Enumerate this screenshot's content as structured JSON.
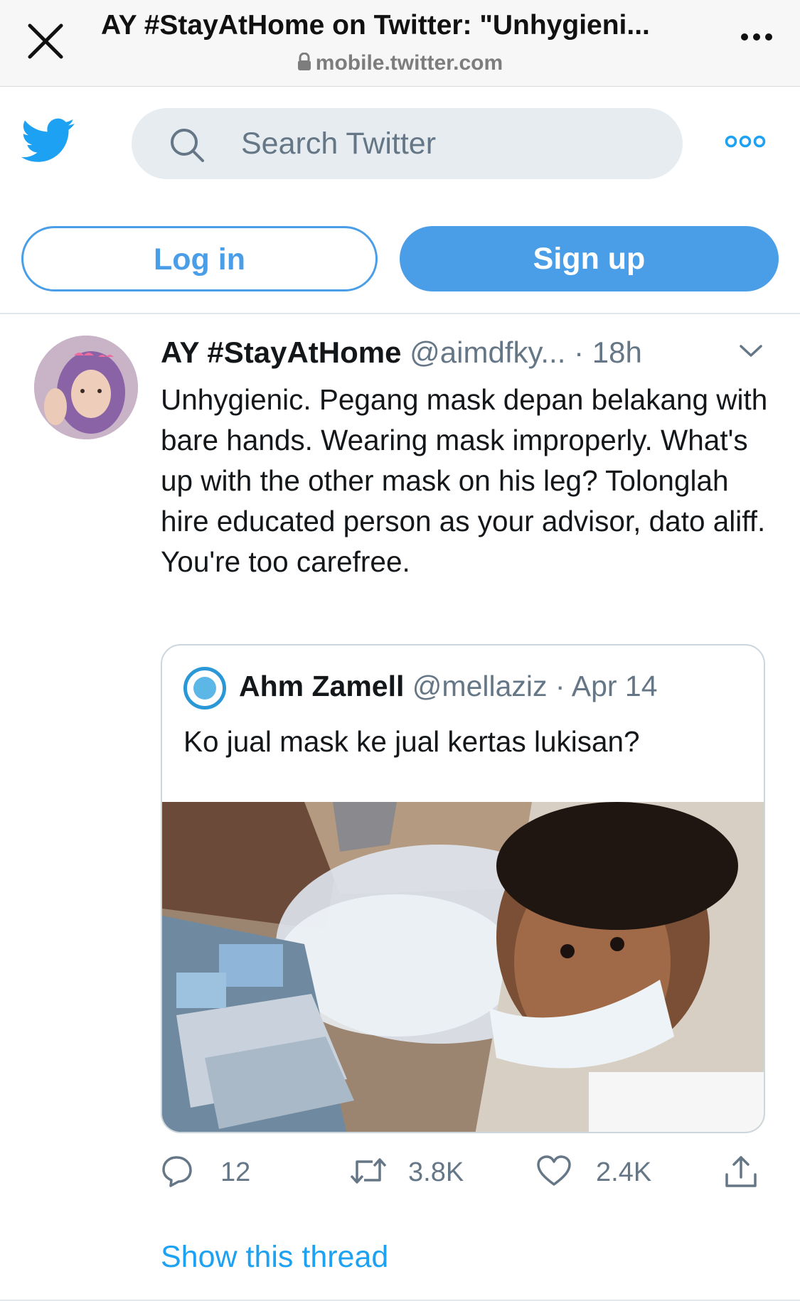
{
  "browser": {
    "title": "AY #StayAtHome on Twitter: \"Unhygieni...",
    "url": "mobile.twitter.com",
    "icons": [
      "close-icon",
      "lock-icon",
      "more-icon"
    ]
  },
  "header": {
    "search_placeholder": "Search Twitter",
    "login_label": "Log in",
    "signup_label": "Sign up",
    "icons": [
      "twitter-logo-icon",
      "search-icon",
      "more-options-icon"
    ]
  },
  "tweet": {
    "author_name": "AY #StayAtHome",
    "author_handle": "@aimdfky...",
    "separator": "·",
    "time": "18h",
    "text": "Unhygienic. Pegang mask depan belakang with bare hands. Wearing mask improperly. What's up with the other mask on his leg? Tolonglah hire educated person as your advisor, dato aliff. You're too carefree.",
    "quote": {
      "author_name": "Ahm Zamell",
      "author_handle": "@mellaziz",
      "separator": "·",
      "date": "Apr 14",
      "text": "Ko jual mask ke jual kertas lukisan?"
    },
    "actions": {
      "replies": "12",
      "retweets": "3.8K",
      "likes": "2.4K"
    },
    "show_thread": "Show this thread"
  },
  "colors": {
    "twitter_blue": "#1da1f2",
    "button_blue": "#4a9ee8",
    "muted_text": "#657786",
    "search_bg": "#e6ecf0"
  }
}
